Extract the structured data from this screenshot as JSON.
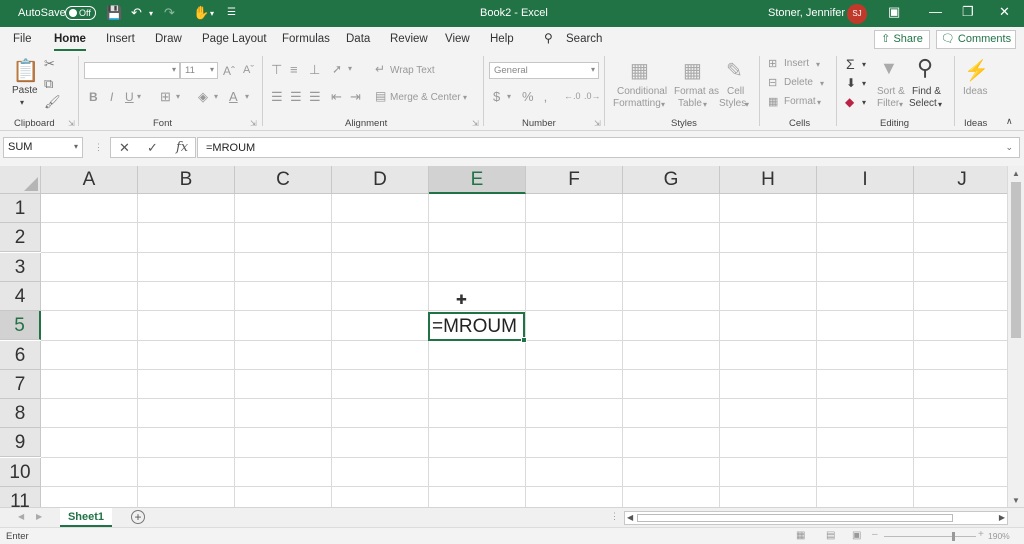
{
  "titlebar": {
    "autosave_label": "AutoSave",
    "autosave_state": "Off",
    "title": "Book2  -  Excel",
    "user_name": "Stoner, Jennifer L",
    "user_initials": "SJ"
  },
  "tabs": [
    {
      "label": "File"
    },
    {
      "label": "Home"
    },
    {
      "label": "Insert"
    },
    {
      "label": "Draw"
    },
    {
      "label": "Page Layout"
    },
    {
      "label": "Formulas"
    },
    {
      "label": "Data"
    },
    {
      "label": "Review"
    },
    {
      "label": "View"
    },
    {
      "label": "Help"
    }
  ],
  "search_label": "Search",
  "share_label": "Share",
  "comments_label": "Comments",
  "ribbon": {
    "paste": "Paste",
    "clipboard": "Clipboard",
    "font_size": "11",
    "font": "Font",
    "wrap_text": "Wrap Text",
    "merge_center": "Merge & Center",
    "alignment": "Alignment",
    "number_format": "General",
    "number": "Number",
    "conditional_line1": "Conditional",
    "conditional_line2": "Formatting",
    "format_table_line1": "Format as",
    "format_table_line2": "Table",
    "cell_styles_line1": "Cell",
    "cell_styles_line2": "Styles",
    "styles": "Styles",
    "insert": "Insert",
    "delete": "Delete",
    "format": "Format",
    "cells": "Cells",
    "sort_line1": "Sort &",
    "sort_line2": "Filter",
    "find_line1": "Find &",
    "find_line2": "Select",
    "editing": "Editing",
    "ideas_btn": "Ideas",
    "ideas": "Ideas"
  },
  "formula_bar": {
    "name_box": "SUM",
    "formula": "=MROUM"
  },
  "grid": {
    "columns": [
      "A",
      "B",
      "C",
      "D",
      "E",
      "F",
      "G",
      "H",
      "I",
      "J"
    ],
    "rows": [
      "1",
      "2",
      "3",
      "4",
      "5",
      "6",
      "7",
      "8",
      "9",
      "10",
      "11"
    ],
    "active_cell_value": "=MROUM"
  },
  "sheets": [
    {
      "name": "Sheet1"
    }
  ],
  "status": {
    "mode": "Enter",
    "zoom": "190%"
  }
}
